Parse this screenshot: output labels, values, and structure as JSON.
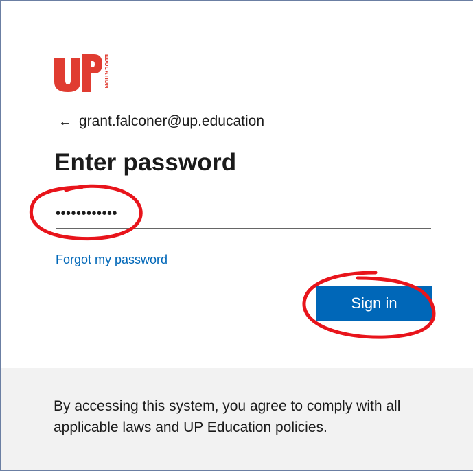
{
  "brand": {
    "logo_letters": "UP",
    "logo_side_text": "EDUCATION",
    "accent_color": "#e03c31"
  },
  "identity": {
    "back_icon": "arrow-left-icon",
    "back_glyph": "←",
    "email": "grant.falconer@up.education"
  },
  "form": {
    "title": "Enter password",
    "password_mask": "••••••••••••",
    "forgot_link": "Forgot my password",
    "signin_label": "Sign in",
    "primary_color": "#0067b8"
  },
  "footer": {
    "notice": "By accessing this system, you agree to comply with all applicable laws and UP Education policies."
  },
  "annotations": {
    "color": "#e8141b"
  }
}
